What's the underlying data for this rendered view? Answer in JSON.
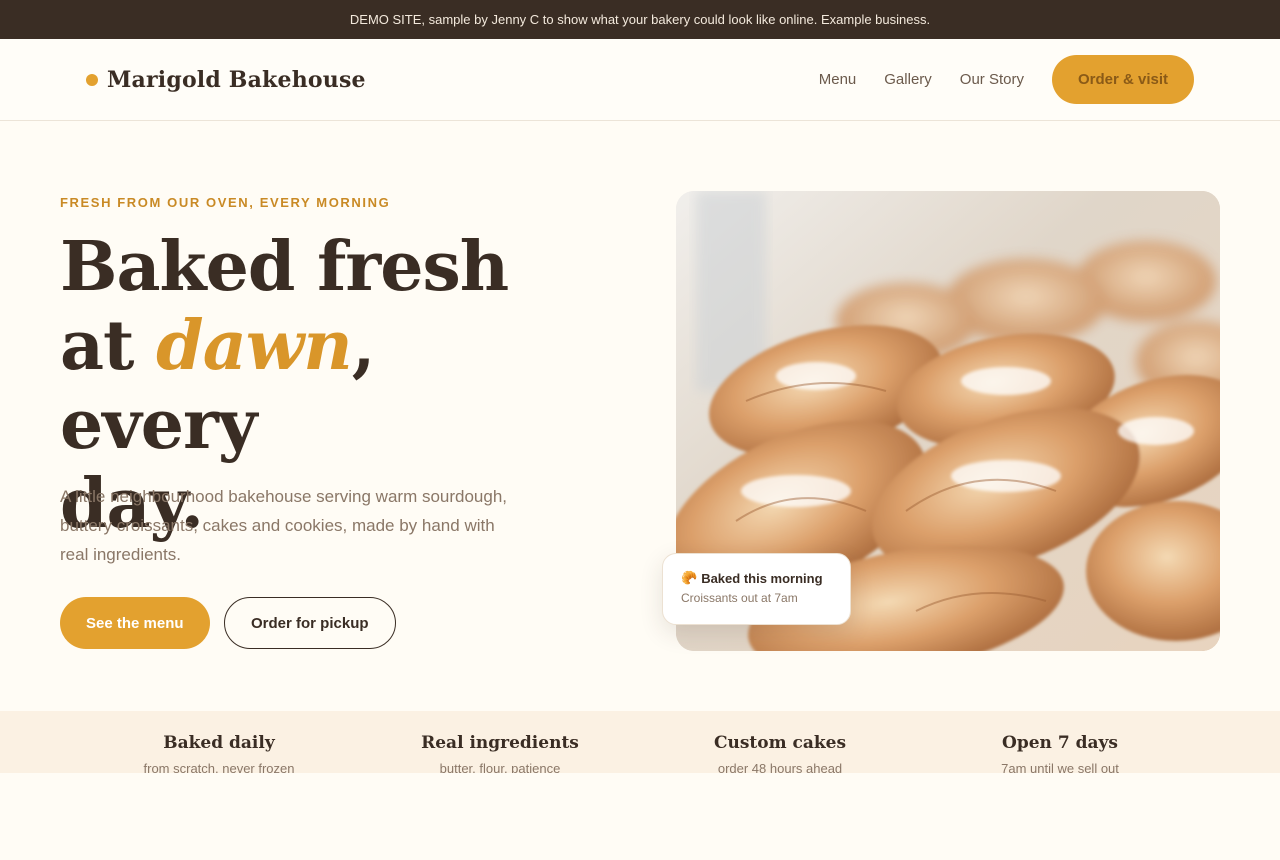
{
  "banner": {
    "text": "DEMO SITE, sample by Jenny C to show what your bakery could look like online. Example business."
  },
  "brand": {
    "name": "Marigold Bakehouse"
  },
  "nav": {
    "links": [
      "Menu",
      "Gallery",
      "Our Story"
    ],
    "cta": "Order & visit"
  },
  "hero": {
    "eyebrow": "FRESH FROM OUR OVEN, EVERY MORNING",
    "title_line1": "Baked fresh",
    "title_at": "at ",
    "title_accent": "dawn",
    "title_rest": ", every",
    "title_line3": "day.",
    "lead": "A little neighbourhood bakehouse serving warm sourdough, buttery croissants, cakes and cookies, made by hand with real ingredients.",
    "primary_button": "See the menu",
    "secondary_button": "Order for pickup"
  },
  "floating_card": {
    "icon": "croissant-icon",
    "emoji": "🥐",
    "title": "Baked this morning",
    "subtitle": "Croissants out at 7am"
  },
  "features": [
    {
      "title": "Baked daily",
      "subtitle": "from scratch, never frozen"
    },
    {
      "title": "Real ingredients",
      "subtitle": "butter, flour, patience"
    },
    {
      "title": "Custom cakes",
      "subtitle": "order 48 hours ahead"
    },
    {
      "title": "Open 7 days",
      "subtitle": "7am until we sell out"
    }
  ],
  "colors": {
    "accent": "#e3a12f",
    "dark": "#3a2d24",
    "background": "#fffcf5",
    "muted": "#8a7767"
  }
}
